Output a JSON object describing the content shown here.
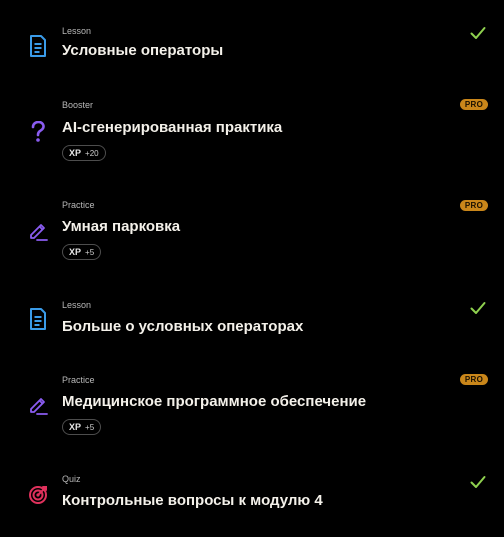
{
  "colors": {
    "background": "#000000",
    "lesson_icon": "#3a9be8",
    "booster_icon": "#8a5cf0",
    "practice_icon": "#8a5cf0",
    "quiz_icon": "#e0315c",
    "check": "#8fd14f",
    "pro_badge": "#c9861a"
  },
  "items": [
    {
      "type": "Lesson",
      "title": "Условные операторы",
      "icon": "document-icon",
      "completed": true
    },
    {
      "type": "Booster",
      "title": "AI-сгенерированная практика",
      "icon": "question-icon",
      "badge": "PRO",
      "xp_label": "XP",
      "xp_value": "+20"
    },
    {
      "type": "Practice",
      "title": "Умная парковка",
      "icon": "pencil-icon",
      "badge": "PRO",
      "xp_label": "XP",
      "xp_value": "+5"
    },
    {
      "type": "Lesson",
      "title": "Больше о условных операторах",
      "icon": "document-icon",
      "completed": true
    },
    {
      "type": "Practice",
      "title": "Медицинское программное обеспечение",
      "icon": "pencil-icon",
      "badge": "PRO",
      "xp_label": "XP",
      "xp_value": "+5"
    },
    {
      "type": "Quiz",
      "title": "Контрольные вопросы к модулю 4",
      "icon": "target-icon",
      "completed": true
    }
  ]
}
